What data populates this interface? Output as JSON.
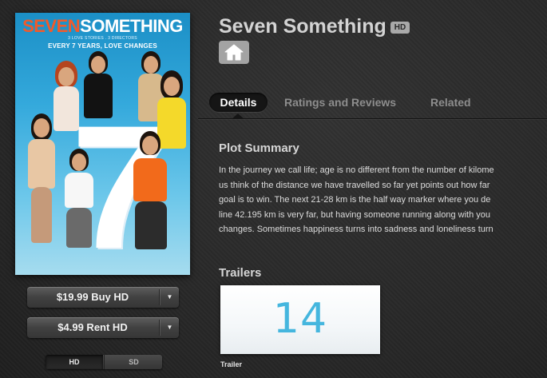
{
  "poster": {
    "title_word1": "SEVEN",
    "title_word2": "SOMETHING",
    "credits": "3 LOVE STORIES . 3 DIRECTORS",
    "tagline": "EVERY 7 YEARS, LOVE CHANGES",
    "big_number": "7"
  },
  "purchase": {
    "buy_label": "$19.99 Buy HD",
    "rent_label": "$4.99 Rent HD",
    "dropdown_glyph": "▼",
    "quality_options": [
      "HD",
      "SD"
    ],
    "quality_selected": "HD"
  },
  "header": {
    "title": "Seven Something",
    "badge": "HD",
    "home_icon": "home-icon"
  },
  "tabs": [
    {
      "label": "Details",
      "active": true
    },
    {
      "label": "Ratings and Reviews",
      "active": false
    },
    {
      "label": "Related",
      "active": false
    }
  ],
  "plot": {
    "heading": "Plot Summary",
    "lines": [
      "In the journey we call life; age is no different from the number of kilome",
      "us think of the distance we have travelled so far yet points out how far",
      "goal is to win. The next 21-28 km is the half way marker where you de",
      "line 42.195 km is very far, but having someone running along with you",
      "changes. Sometimes happiness turns into sadness and loneliness turn"
    ]
  },
  "trailers": {
    "heading": "Trailers",
    "items": [
      {
        "thumb_text": "14",
        "label": "Trailer"
      }
    ]
  },
  "colors": {
    "background": "#2a2a2a",
    "accent_orange": "#f15a2b",
    "poster_blue": "#34a9dc",
    "text_light": "#dcdcdc",
    "tab_inactive": "#8d8d8d"
  }
}
